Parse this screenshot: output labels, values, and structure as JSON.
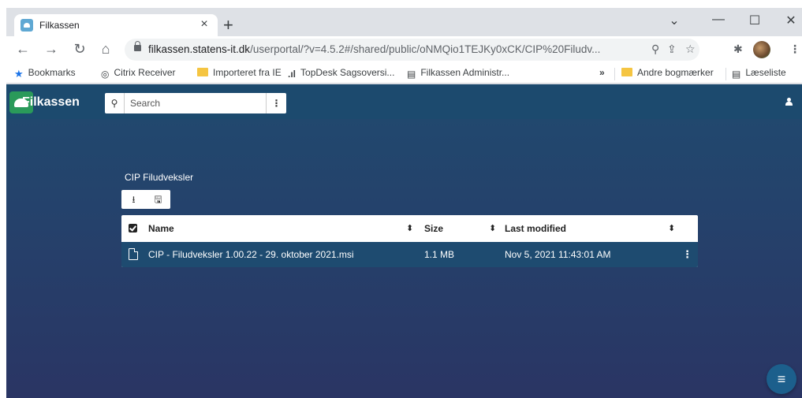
{
  "browser": {
    "tab": {
      "title": "Filkassen",
      "close": "×"
    },
    "new_tab": "+",
    "window_controls": {
      "dropdown": "⌄",
      "minimize": "—",
      "maximize": "☐",
      "close": "✕"
    },
    "nav": {
      "back": "←",
      "forward": "→",
      "reload": "↻",
      "home": "⌂"
    },
    "address": {
      "domain": "filkassen.statens-it.dk",
      "path": "/userportal/?v=4.5.2#/shared/public/oNMQio1TEJKy0xCK/CIP%20Filudv..."
    },
    "omnibox_icons": {
      "zoom": "⚲",
      "share": "⇪",
      "star": "☆"
    },
    "extensions_icon": "✱",
    "menu_icon": "⋮"
  },
  "bookmarks": {
    "items": [
      {
        "label": "Bookmarks",
        "icon": "star-icon"
      },
      {
        "label": "Citrix Receiver",
        "icon": "citrix-icon"
      },
      {
        "label": "Importeret fra IE",
        "icon": "folder-icon"
      },
      {
        "label": "TopDesk Sagsoversi...",
        "icon": "bars-icon"
      },
      {
        "label": "Filkassen Administr...",
        "icon": "page-icon"
      }
    ],
    "overflow": "»",
    "other": "Andre bogmærker",
    "reading_list": "Læseliste"
  },
  "app": {
    "logo_text": "Filkassen",
    "search": {
      "placeholder": "Search",
      "search_icon": "⚲",
      "menu_icon": "⋮"
    },
    "folder_title": "CIP Filudveksler",
    "actions": {
      "download": "⭳",
      "save": "🖫"
    },
    "table": {
      "columns": [
        "Name",
        "Size",
        "Last modified"
      ],
      "sort_icon": "⬍",
      "rows": [
        {
          "name": "CIP - Filudveksler 1.00.22 - 29. oktober 2021.msi",
          "size": "1.1 MB",
          "modified": "Nov 5, 2021 11:43:01 AM",
          "menu": "⋮"
        }
      ]
    },
    "fab_icon": "≡"
  },
  "colors": {
    "header": "#1c4a6e",
    "selected_row": "#1e4b70",
    "logo": "#2a9a5a"
  }
}
